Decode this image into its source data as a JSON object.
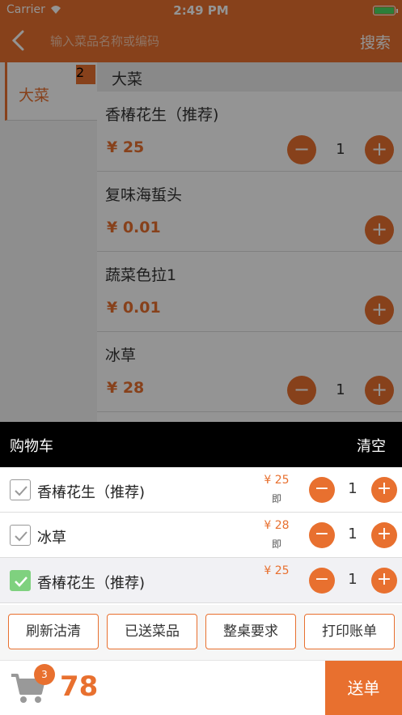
{
  "status": {
    "carrier": "Carrier",
    "time": "2:49 PM"
  },
  "nav": {
    "search_placeholder": "输入菜品名称或编码",
    "search_button": "搜索"
  },
  "sidebar": {
    "category": "大菜",
    "badge": "2"
  },
  "section": {
    "title": "大菜"
  },
  "menu": [
    {
      "name": "香椿花生（推荐)",
      "price": "¥ 25",
      "qty": "1"
    },
    {
      "name": "复味海蜇头",
      "price": "¥ 0.01",
      "qty": ""
    },
    {
      "name": "蔬菜色拉1",
      "price": "¥ 0.01",
      "qty": ""
    },
    {
      "name": "冰草",
      "price": "¥ 28",
      "qty": "1"
    }
  ],
  "cart": {
    "title": "购物车",
    "clear": "清空",
    "items": [
      {
        "name": "香椿花生（推荐)",
        "price": "¥ 25",
        "tag": "即",
        "qty": "1",
        "checked": false
      },
      {
        "name": "冰草",
        "price": "¥ 28",
        "tag": "即",
        "qty": "1",
        "checked": false
      },
      {
        "name": "香椿花生（推荐)",
        "price": "¥ 25",
        "tag": "",
        "qty": "1",
        "checked": true
      }
    ],
    "actions": [
      "刷新沽清",
      "已送菜品",
      "整桌要求",
      "打印账单"
    ],
    "count": "3",
    "total": "78",
    "submit": "送单"
  },
  "colors": {
    "accent": "#e8702f",
    "check": "#7fd17f"
  }
}
